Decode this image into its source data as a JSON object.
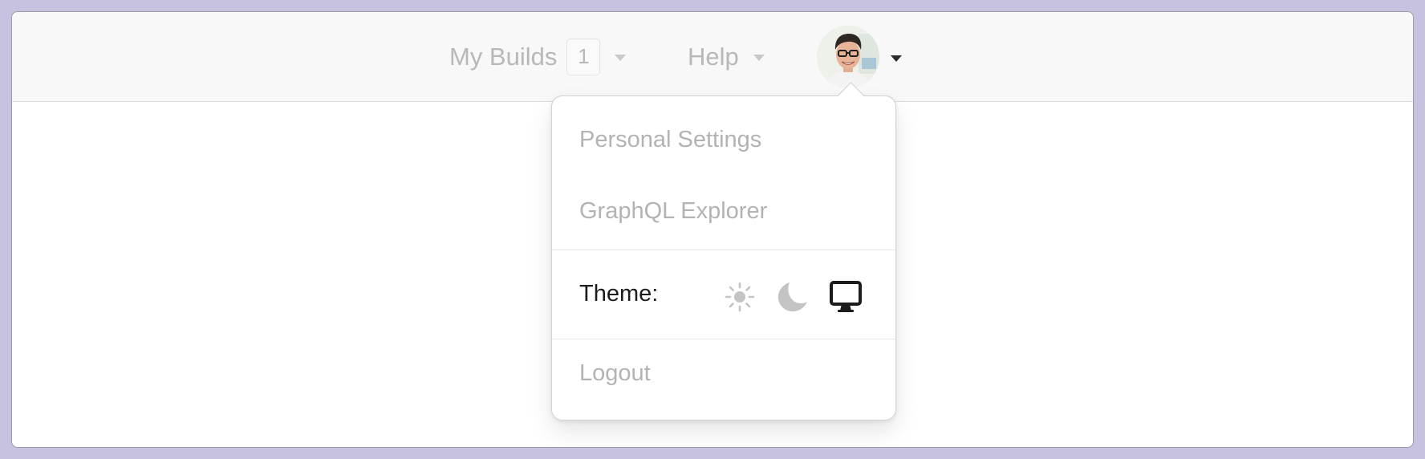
{
  "nav": {
    "my_builds_label": "My Builds",
    "my_builds_count": "1",
    "help_label": "Help"
  },
  "user_menu": {
    "items": [
      {
        "label": "Personal Settings"
      },
      {
        "label": "GraphQL Explorer"
      }
    ],
    "theme_label": "Theme:",
    "theme_options": [
      {
        "name": "light",
        "icon": "sun-icon",
        "selected": false
      },
      {
        "name": "dark",
        "icon": "moon-icon",
        "selected": false
      },
      {
        "name": "system",
        "icon": "monitor-icon",
        "selected": true
      }
    ],
    "logout_label": "Logout"
  },
  "colors": {
    "muted_text": "#b8b8b8",
    "selected_icon": "#1c1c1c",
    "unselected_icon": "#c4c4c4"
  }
}
